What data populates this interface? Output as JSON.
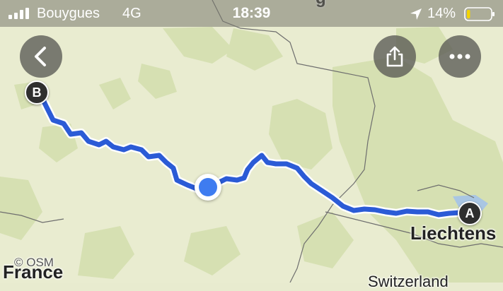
{
  "status_bar": {
    "carrier": "Bouygues",
    "network": "4G",
    "time": "18:39",
    "battery_percent": "14%",
    "battery_level": 0.14,
    "battery_color": "#f3d400"
  },
  "map": {
    "attribution": "© OSM",
    "labels": {
      "country_france": "France",
      "country_switzerland": "Switzerland",
      "liechtenstein": "Liechtens",
      "top_partial": "g"
    },
    "route_color": "#2b5bd6",
    "start_marker": "A",
    "end_marker": "B"
  },
  "buttons": {
    "back_icon": "chevron-left-icon",
    "share_icon": "share-icon",
    "more_icon": "more-icon"
  }
}
